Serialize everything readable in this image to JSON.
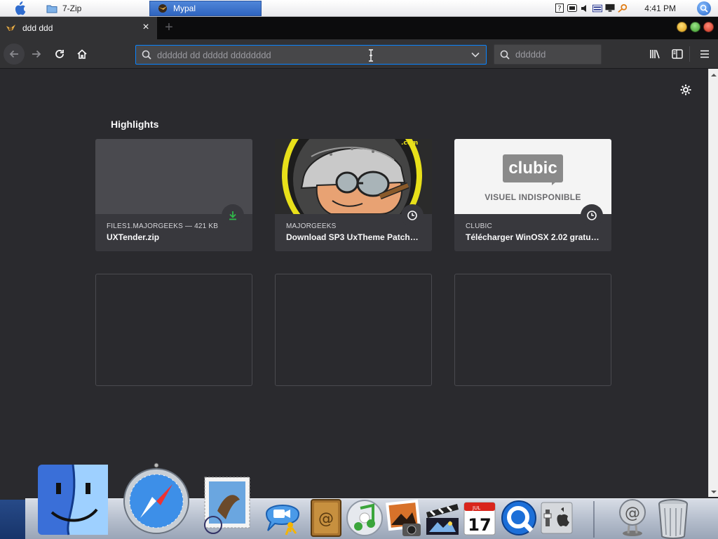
{
  "os_taskbar": {
    "tasks": [
      {
        "label": "7-Zip",
        "icon": "folder-icon"
      },
      {
        "label": "Mypal",
        "icon": "mypal-icon",
        "active": true
      }
    ],
    "clock": "4:41 PM",
    "tray_icons": [
      "help-icon",
      "volume-icon",
      "speaker-icon",
      "network-icon",
      "monitor-icon",
      "key-icon"
    ]
  },
  "browser": {
    "tab": {
      "title": "ddd ddd",
      "close_glyph": "×"
    },
    "new_tab_glyph": "+",
    "url_placeholder": "dddddd dd ddddd dddddddd",
    "search_placeholder": "dddddd"
  },
  "newtab": {
    "section_title": "Highlights",
    "cards": [
      {
        "host": "FILES1.MAJORGEEKS — 421 KB",
        "title": "UXTender.zip",
        "badge": "download-icon",
        "thumb": "blank"
      },
      {
        "host": "MAJORGEEKS",
        "title": "Download SP3 UxTheme Patcher ...",
        "badge": "clock-icon",
        "thumb": "majorgeeks-mascot"
      },
      {
        "host": "CLUBIC",
        "title": "Télécharger WinOSX 2.02 gratuit ...",
        "badge": "clock-icon",
        "thumb": "clubic-logo",
        "thumb_logo": "clubic",
        "thumb_caption": "VISUEL INDISPONIBLE"
      }
    ],
    "empty_slots": 3
  },
  "dock": {
    "items": [
      "finder-icon",
      "safari-icon",
      "mail-icon",
      "ichat-icon",
      "address-book-icon",
      "itunes-icon",
      "iphoto-icon",
      "imovie-icon",
      "ical-icon",
      "quicktime-icon",
      "system-preferences-icon",
      "mail-server-icon",
      "trash-icon"
    ],
    "ical_day": "17",
    "ical_month": "JUL"
  },
  "colors": {
    "accent": "#0a84ff",
    "download_green": "#30b84a",
    "content_bg": "#2a2a2e",
    "card_bg": "#38383d"
  }
}
